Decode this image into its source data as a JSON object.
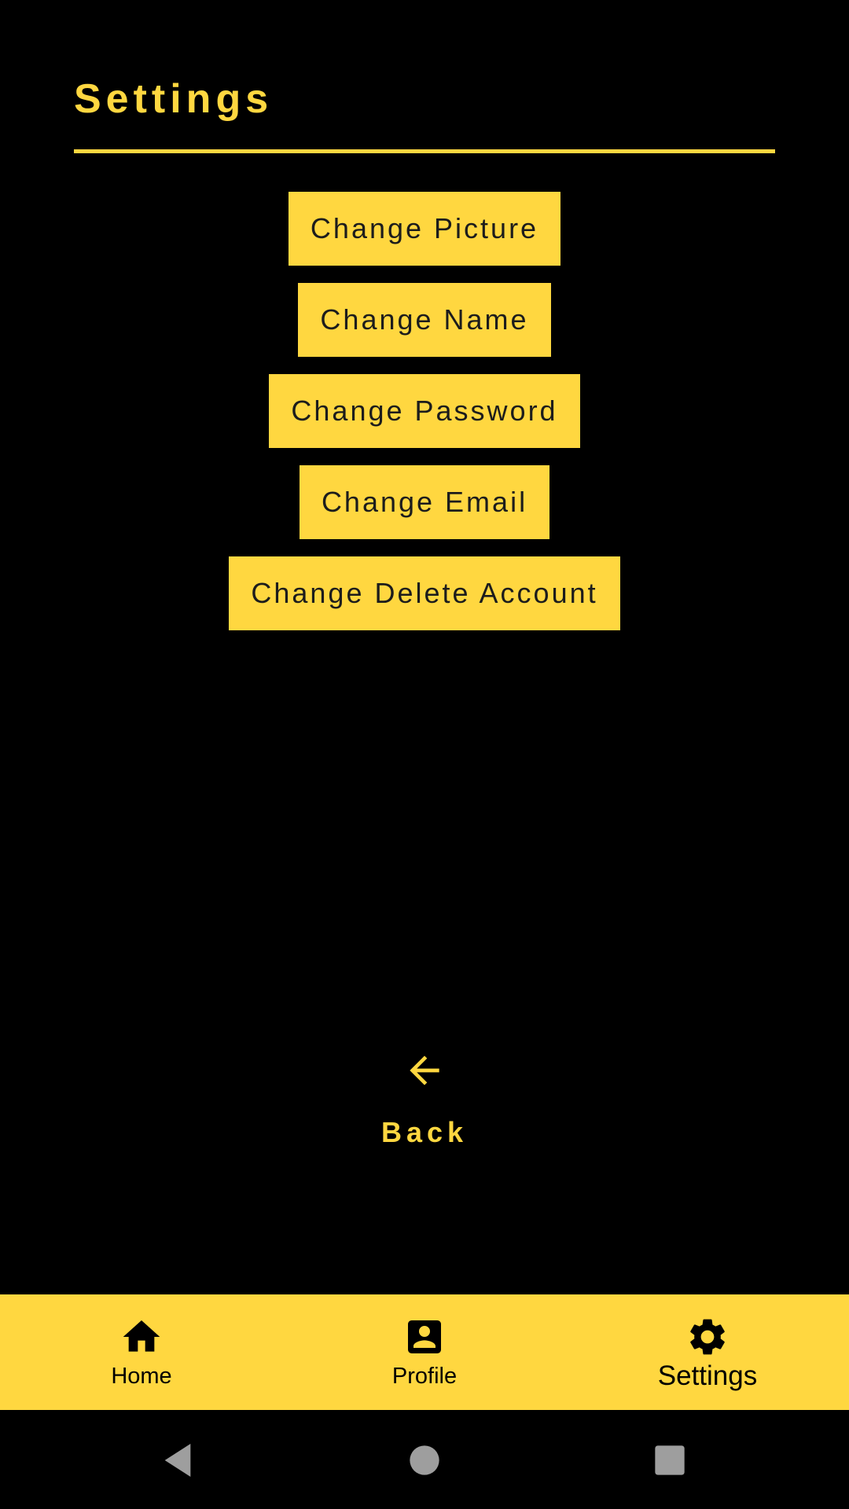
{
  "header": {
    "title": "Settings"
  },
  "actions": [
    {
      "label": "Change Picture"
    },
    {
      "label": "Change Name"
    },
    {
      "label": "Change Password"
    },
    {
      "label": "Change Email"
    },
    {
      "label": "Change Delete Account"
    }
  ],
  "back": {
    "label": "Back",
    "icon": "arrow-back-icon"
  },
  "bottom_nav": {
    "items": [
      {
        "label": "Home",
        "icon": "home-icon"
      },
      {
        "label": "Profile",
        "icon": "profile-icon"
      },
      {
        "label": "Settings",
        "icon": "gear-icon",
        "active": true
      }
    ]
  },
  "system_nav": {
    "icons": [
      "back-triangle-icon",
      "home-circle-icon",
      "recents-square-icon"
    ]
  },
  "colors": {
    "accent": "#FFD740",
    "background": "#000000",
    "system_icon": "#9E9E9E"
  }
}
